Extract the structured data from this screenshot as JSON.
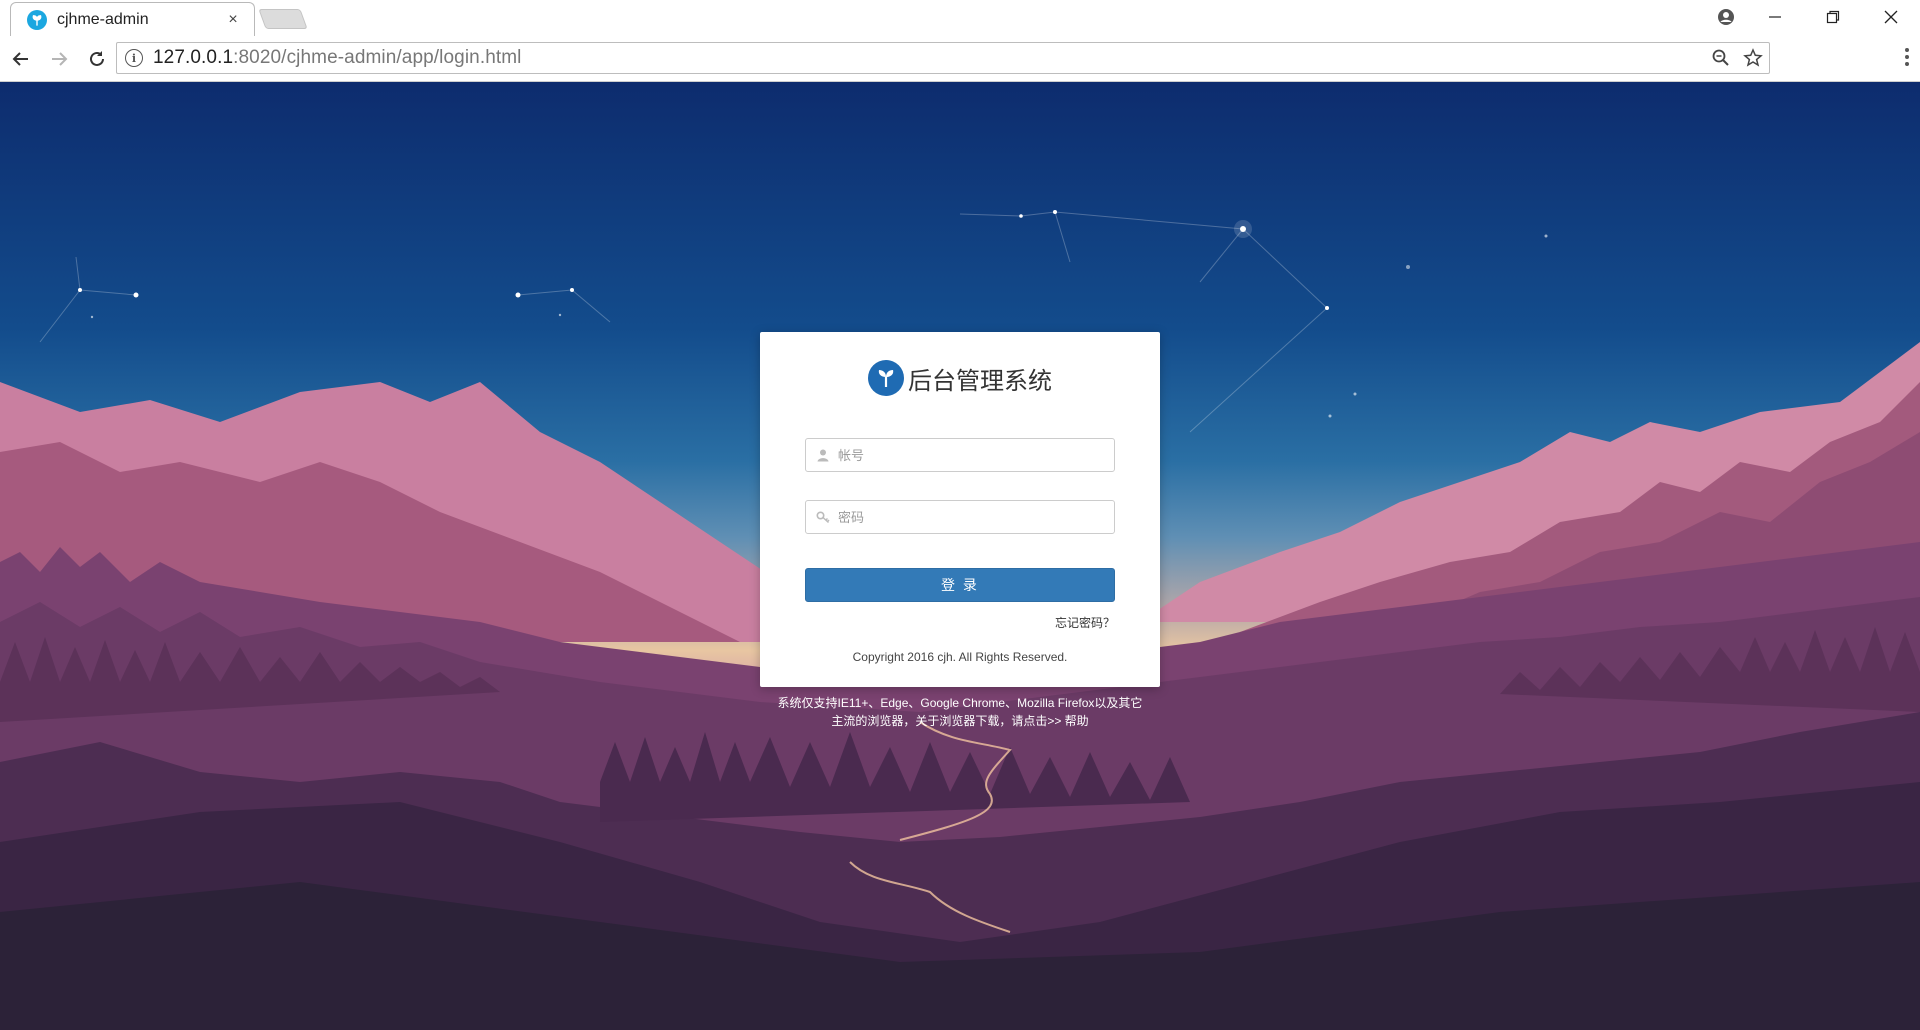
{
  "browser": {
    "tab_title": "cjhme-admin",
    "tab_close": "×",
    "url_host": "127.0.0.1",
    "url_rest": ":8020/cjhme-admin/app/login.html"
  },
  "login": {
    "title": "后台管理系统",
    "username_placeholder": "帐号",
    "password_placeholder": "密码",
    "submit_label": "登 录",
    "forgot_label": "忘记密码？",
    "copyright": "Copyright 2016 cjh. All Rights Reserved."
  },
  "notice": {
    "line1": "系统仅支持IE11+、Edge、Google Chrome、Mozilla Firefox以及其它",
    "line2_prefix": "主流的浏览器，关于浏览器下载，请点击>> ",
    "help_link": "帮助"
  },
  "colors": {
    "accent": "#337ab7",
    "favicon": "#1ba7e0",
    "logo": "#1f6bb3"
  }
}
